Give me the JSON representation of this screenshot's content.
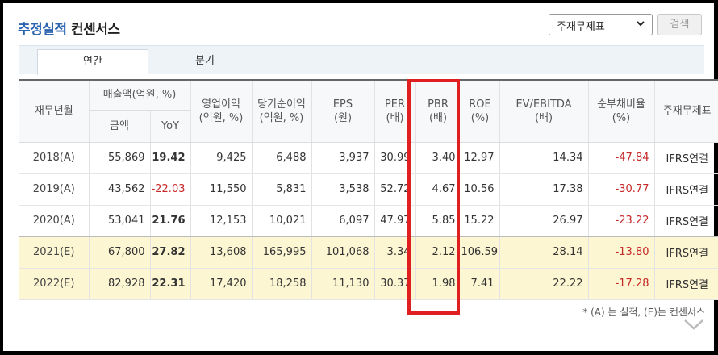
{
  "header": {
    "title_part1": "추정실적",
    "title_part2": "컨센서스",
    "select_value": "주재무제표",
    "search_label": "검색"
  },
  "tabs": [
    {
      "label": "연간",
      "active": true
    },
    {
      "label": "분기",
      "active": false
    }
  ],
  "table": {
    "headers": {
      "period": "재무년월",
      "sales_group": "매출액(억원, %)",
      "sales_amount": "금액",
      "sales_yoy": "YoY",
      "op_income": "영업이익",
      "op_income_unit": "(억원, %)",
      "net_income": "당기순이익",
      "net_income_unit": "(억원, %)",
      "eps": "EPS",
      "eps_unit": "(원)",
      "per": "PER",
      "per_unit": "(배)",
      "pbr": "PBR",
      "pbr_unit": "(배)",
      "roe": "ROE",
      "roe_unit": "(%)",
      "ev_ebitda": "EV/EBITDA",
      "ev_ebitda_unit": "(배)",
      "debt_ratio": "순부채비율",
      "debt_ratio_unit": "(%)",
      "statement": "주재무제표"
    },
    "rows": [
      {
        "period": "2018(A)",
        "sales": "55,869",
        "yoy": "19.42",
        "op": "9,425",
        "net": "6,488",
        "eps": "3,937",
        "per": "30.99",
        "pbr": "3.40",
        "roe": "12.97",
        "ev": "14.34",
        "debt": "-47.84",
        "stmt": "IFRS연결"
      },
      {
        "period": "2019(A)",
        "sales": "43,562",
        "yoy": "-22.03",
        "op": "11,550",
        "net": "5,831",
        "eps": "3,538",
        "per": "52.72",
        "pbr": "4.67",
        "roe": "10.56",
        "ev": "17.38",
        "debt": "-30.77",
        "stmt": "IFRS연결"
      },
      {
        "period": "2020(A)",
        "sales": "53,041",
        "yoy": "21.76",
        "op": "12,153",
        "net": "10,021",
        "eps": "6,097",
        "per": "47.97",
        "pbr": "5.85",
        "roe": "15.22",
        "ev": "26.97",
        "debt": "-23.22",
        "stmt": "IFRS연결"
      },
      {
        "period": "2021(E)",
        "sales": "67,800",
        "yoy": "27.82",
        "op": "13,608",
        "net": "165,995",
        "eps": "101,068",
        "per": "3.34",
        "pbr": "2.12",
        "roe": "106.59",
        "ev": "28.14",
        "debt": "-13.80",
        "stmt": "IFRS연결"
      },
      {
        "period": "2022(E)",
        "sales": "82,928",
        "yoy": "22.31",
        "op": "17,420",
        "net": "18,258",
        "eps": "11,130",
        "per": "30.37",
        "pbr": "1.98",
        "roe": "7.41",
        "ev": "22.22",
        "debt": "-17.28",
        "stmt": "IFRS연결"
      }
    ]
  },
  "footnote": "* (A) 는 실적, (E)는 컨센서스",
  "colors": {
    "title_accent": "#2d64b0",
    "negative": "#c62828",
    "estimate_row_bg": "#fdf6d3",
    "highlight_box": "#e02020"
  }
}
